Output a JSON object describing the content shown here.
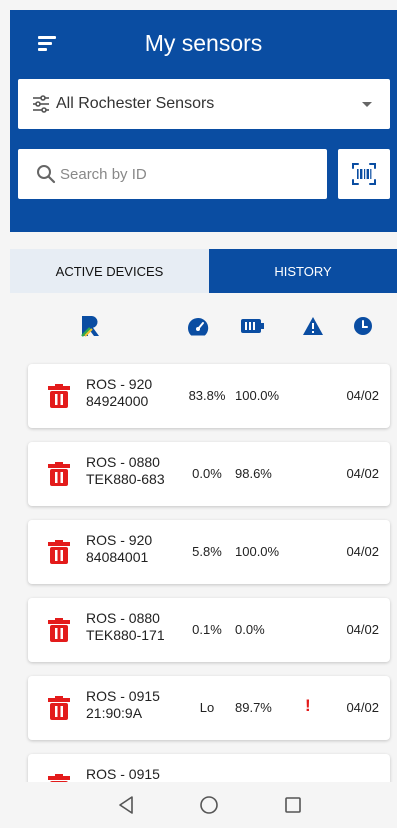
{
  "header": {
    "title": "My sensors",
    "menu_icon": "hamburger-menu-icon"
  },
  "filter": {
    "selected": "All Rochester Sensors",
    "icon": "sliders-icon"
  },
  "search": {
    "placeholder": "Search by ID",
    "value": "",
    "icon": "search-icon"
  },
  "scan": {
    "icon": "barcode-scan-icon"
  },
  "tabs": [
    {
      "label": "ACTIVE DEVICES",
      "selected": true
    },
    {
      "label": "HISTORY",
      "selected": false
    }
  ],
  "columns": [
    "rochester-logo-icon",
    "speedometer-icon",
    "battery-icon",
    "warning-icon",
    "clock-icon"
  ],
  "devices": [
    {
      "id_line1": "ROS - 920",
      "id_line2": "84924000",
      "speed": "83.8%",
      "battery": "100.0%",
      "alert": "",
      "date": "04/02"
    },
    {
      "id_line1": "ROS - 0880",
      "id_line2": "TEK880-683",
      "speed": "0.0%",
      "battery": "98.6%",
      "alert": "",
      "date": "04/02"
    },
    {
      "id_line1": "ROS - 920",
      "id_line2": "84084001",
      "speed": "5.8%",
      "battery": "100.0%",
      "alert": "",
      "date": "04/02"
    },
    {
      "id_line1": "ROS - 0880",
      "id_line2": "TEK880-171",
      "speed": "0.1%",
      "battery": "0.0%",
      "alert": "",
      "date": "04/02"
    },
    {
      "id_line1": "ROS - 0915",
      "id_line2": "21:90:9A",
      "speed": "Lo",
      "battery": "89.7%",
      "alert": "!",
      "date": "04/02"
    },
    {
      "id_line1": "ROS - 0915",
      "id_line2": "",
      "speed": "",
      "battery": "",
      "alert": "",
      "date": ""
    }
  ],
  "colors": {
    "brand": "#0a4da2",
    "danger": "#e31b1b",
    "tab_inactive": "#e7edf4"
  },
  "navbar": [
    "back-icon",
    "home-icon",
    "recents-icon"
  ]
}
